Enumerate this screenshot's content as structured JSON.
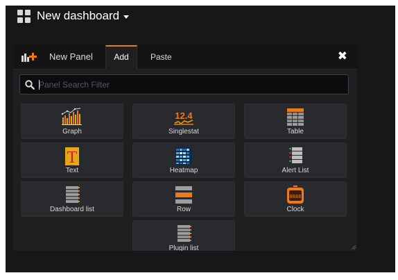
{
  "header": {
    "dashboard_title": "New dashboard"
  },
  "panel_picker": {
    "title": "New Panel",
    "tabs": [
      {
        "label": "Add",
        "active": true
      },
      {
        "label": "Paste",
        "active": false
      }
    ],
    "search": {
      "placeholder": "Panel Search Filter",
      "value": ""
    },
    "items": [
      {
        "label": "Graph",
        "icon": "graph-icon"
      },
      {
        "label": "Singlestat",
        "icon": "singlestat-icon",
        "icon_text": "12.4"
      },
      {
        "label": "Table",
        "icon": "table-icon"
      },
      {
        "label": "Text",
        "icon": "text-icon",
        "icon_text": "T"
      },
      {
        "label": "Heatmap",
        "icon": "heatmap-icon"
      },
      {
        "label": "Alert List",
        "icon": "alert-list-icon"
      },
      {
        "label": "Dashboard list",
        "icon": "dashboard-list-icon"
      },
      {
        "label": "Row",
        "icon": "row-icon"
      },
      {
        "label": "Clock",
        "icon": "clock-icon",
        "icon_text": "8888"
      },
      {
        "label": "Plugin list",
        "icon": "plugin-list-icon"
      }
    ]
  },
  "colors": {
    "background": "#161719",
    "panel": "#1f1f20",
    "card": "#292a2d",
    "accent": "#eb7b18",
    "text": "#d8d9da"
  }
}
